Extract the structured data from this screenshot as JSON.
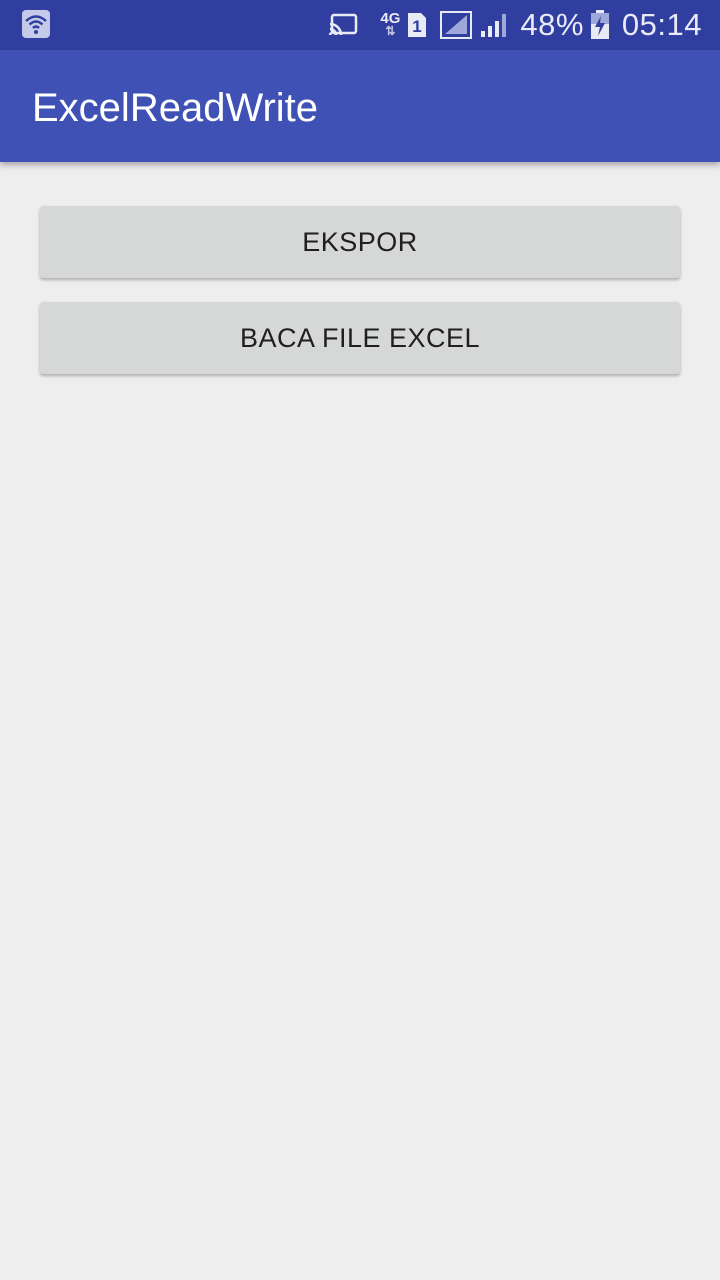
{
  "status_bar": {
    "network_type": "4G",
    "sim_slot": "1",
    "battery_percent": "48%",
    "time": "05:14",
    "icons": [
      "wifi-icon",
      "cast-icon",
      "data-transfer-icon",
      "sim-1-icon",
      "signal-empty-icon",
      "signal-icon",
      "battery-charging-icon"
    ]
  },
  "app_bar": {
    "title": "ExcelReadWrite"
  },
  "main": {
    "buttons": [
      {
        "label": "EKSPOR"
      },
      {
        "label": "BACA FILE EXCEL"
      }
    ]
  },
  "colors": {
    "status_bar": "#303f9f",
    "app_bar": "#3f51b5",
    "background": "#eeeeee",
    "button": "#d6d7d7"
  }
}
